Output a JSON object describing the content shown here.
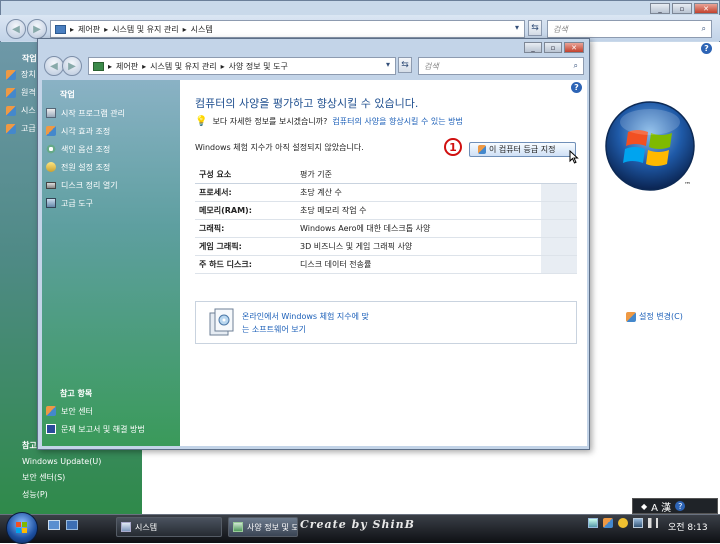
{
  "back_window": {
    "breadcrumb": [
      "제어판",
      "시스템 및 유지 관리",
      "시스템"
    ],
    "search_placeholder": "검색",
    "sidebar_top_fragments": [
      "작업",
      "장치",
      "원격",
      "시스",
      "고급"
    ],
    "sidebar_bottom_heading": "참고",
    "sidebar_bottom_links": [
      "Windows Update(U)",
      "보안 센터(S)",
      "성능(P)"
    ],
    "settings_change_link": "설정 변경(C)",
    "logo_tm": "™"
  },
  "front_window": {
    "breadcrumb": [
      "제어판",
      "시스템 및 유지 관리",
      "사양 정보 및 도구"
    ],
    "search_placeholder": "검색",
    "sidebar": {
      "tasks_heading": "작업",
      "tasks": [
        {
          "label": "시작 프로그램 관리",
          "icon": "startup-programs-icon"
        },
        {
          "label": "시각 효과 조정",
          "icon": "shield-icon"
        },
        {
          "label": "색인 옵션 조정",
          "icon": "index-options-icon"
        },
        {
          "label": "전원 설정 조정",
          "icon": "power-settings-icon"
        },
        {
          "label": "디스크 정리 열기",
          "icon": "disk-cleanup-icon"
        },
        {
          "label": "고급 도구",
          "icon": "advanced-tools-icon"
        }
      ],
      "see_also_heading": "참고 항목",
      "see_also": [
        {
          "label": "보안 센터",
          "icon": "security-center-icon"
        },
        {
          "label": "문제 보고서 및 해결 방법",
          "icon": "problem-reports-icon"
        }
      ]
    },
    "main": {
      "title": "컴퓨터의 사양을 평가하고 향상시킬 수 있습니다.",
      "tip_prefix": "보다 자세한 정보를 보시겠습니까?",
      "tip_link": "컴퓨터의 사양을 향상시킬 수 있는 방법",
      "status_text": "Windows 체험 지수가 아직 설정되지 않았습니다.",
      "step_marker": "1",
      "rate_button": "이 컴퓨터 등급 지정",
      "table_headers": [
        "구성 요소",
        "평가 기준"
      ],
      "table_rows": [
        {
          "component": "프로세서:",
          "criterion": "초당 계산 수"
        },
        {
          "component": "메모리(RAM):",
          "criterion": "초당 메모리 작업 수"
        },
        {
          "component": "그래픽:",
          "criterion": "Windows Aero에 대한 데스크톱 사양"
        },
        {
          "component": "게임 그래픽:",
          "criterion": "3D 비즈니스 및 게임 그래픽 사양"
        },
        {
          "component": "주 하드 디스크:",
          "criterion": "디스크 데이터 전송률"
        }
      ],
      "software_link_line1": "온라인에서 Windows 체험 지수에 맞",
      "software_link_line2": "는 소프트웨어 보기"
    }
  },
  "taskbar": {
    "buttons": [
      "시스템",
      "사양 정보 및 도구"
    ],
    "watermark": "Create by ShinB",
    "language_bar": "A 漢",
    "clock": "오전 8:13"
  },
  "colors": {
    "link": "#1b5fb8",
    "title": "#1f4f8f",
    "step_marker": "#d01010"
  }
}
